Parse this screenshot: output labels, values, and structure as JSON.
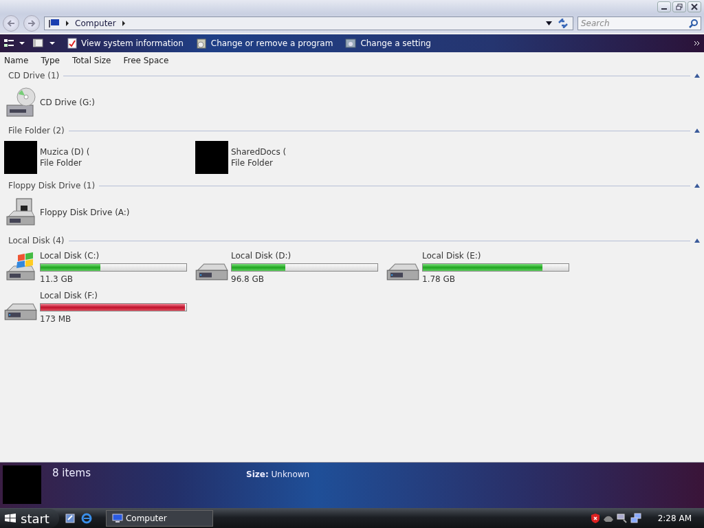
{
  "address_bar": {
    "path": [
      "Computer"
    ]
  },
  "search": {
    "placeholder": "Search"
  },
  "toolbar": {
    "actions": [
      "View system information",
      "Change or remove a program",
      "Change a setting"
    ]
  },
  "columns": [
    "Name",
    "Type",
    "Total Size",
    "Free Space"
  ],
  "groups": [
    {
      "title": "CD Drive (1)",
      "expanded": true,
      "items": [
        {
          "kind": "cd",
          "name": "CD Drive (G:)"
        }
      ]
    },
    {
      "title": "File Folder (2)",
      "expanded": true,
      "items": [
        {
          "kind": "folder",
          "name": "Muzica (D) (",
          "type": "File Folder"
        },
        {
          "kind": "folder",
          "name": "SharedDocs (",
          "type": "File Folder"
        }
      ]
    },
    {
      "title": "Floppy Disk Drive (1)",
      "expanded": true,
      "items": [
        {
          "kind": "floppy",
          "name": "Floppy Disk Drive (A:)"
        }
      ]
    },
    {
      "title": "Local Disk (4)",
      "expanded": true,
      "items": [
        {
          "kind": "system",
          "name": "Local Disk (C:)",
          "level": 0.41,
          "low_space": false,
          "free": "11.3 GB"
        },
        {
          "kind": "disk",
          "name": "Local Disk (D:)",
          "level": 0.37,
          "low_space": false,
          "free": "96.8 GB"
        },
        {
          "kind": "disk",
          "name": "Local Disk (E:)",
          "level": 0.82,
          "low_space": false,
          "free": "1.78 GB"
        },
        {
          "kind": "disk",
          "name": "Local Disk (F:)",
          "level": 0.99,
          "low_space": true,
          "free": "173 MB"
        }
      ]
    }
  ],
  "details": {
    "count": "8 items",
    "size_label": "Size:",
    "size_value": "Unknown"
  },
  "taskbar": {
    "start": "start",
    "windows": [
      {
        "label": "Computer",
        "selected": true
      }
    ],
    "clock": "2:28 AM"
  }
}
